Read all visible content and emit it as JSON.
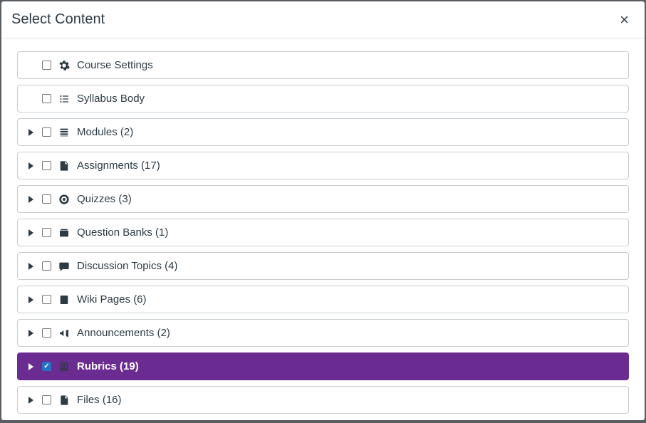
{
  "modal": {
    "title": "Select Content",
    "items": [
      {
        "label": "Course Settings",
        "icon": "gear",
        "expandable": false,
        "checked": false,
        "selected": false
      },
      {
        "label": "Syllabus Body",
        "icon": "syllabus",
        "expandable": false,
        "checked": false,
        "selected": false
      },
      {
        "label": "Modules (2)",
        "icon": "modules",
        "expandable": true,
        "checked": false,
        "selected": false
      },
      {
        "label": "Assignments (17)",
        "icon": "assignments",
        "expandable": true,
        "checked": false,
        "selected": false
      },
      {
        "label": "Quizzes (3)",
        "icon": "quizzes",
        "expandable": true,
        "checked": false,
        "selected": false
      },
      {
        "label": "Question Banks (1)",
        "icon": "question-banks",
        "expandable": true,
        "checked": false,
        "selected": false
      },
      {
        "label": "Discussion Topics (4)",
        "icon": "discussion",
        "expandable": true,
        "checked": false,
        "selected": false
      },
      {
        "label": "Wiki Pages (6)",
        "icon": "wiki",
        "expandable": true,
        "checked": false,
        "selected": false
      },
      {
        "label": "Announcements (2)",
        "icon": "announcements",
        "expandable": true,
        "checked": false,
        "selected": false
      },
      {
        "label": "Rubrics (19)",
        "icon": "rubrics",
        "expandable": true,
        "checked": true,
        "selected": true
      },
      {
        "label": "Files (16)",
        "icon": "files",
        "expandable": true,
        "checked": false,
        "selected": false
      }
    ]
  }
}
